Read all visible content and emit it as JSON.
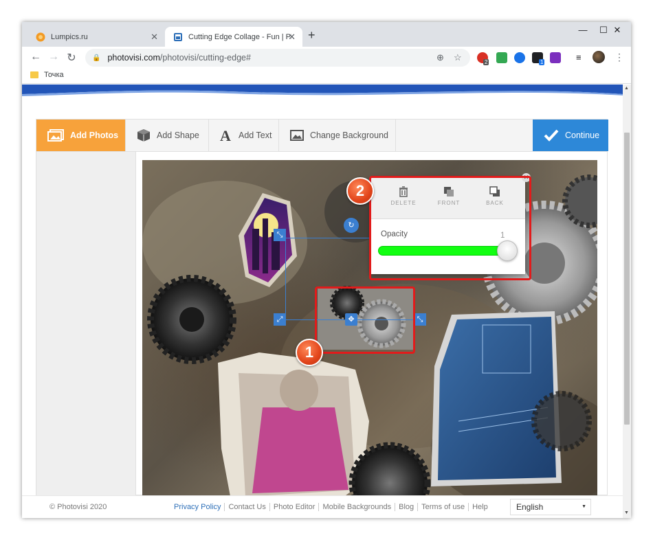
{
  "browser": {
    "tabs": [
      {
        "title": "Lumpics.ru",
        "active": false
      },
      {
        "title": "Cutting Edge Collage - Fun | Photovisi",
        "active": true
      }
    ],
    "new_tab": "+",
    "controls": {
      "minimize": "—",
      "maximize": "☐",
      "close": "✕"
    },
    "url_host": "photovisi.com",
    "url_path": "/photovisi/cutting-edge#",
    "bookmark": "Точка",
    "extension_badges": [
      "2",
      "1"
    ]
  },
  "editor": {
    "tabs": {
      "add_photos": "Add Photos",
      "add_shape": "Add Shape",
      "add_text": "Add Text",
      "change_background": "Change Background",
      "continue": "Continue"
    },
    "popup": {
      "delete": "DELETE",
      "front": "FRONT",
      "back": "BACK",
      "opacity_label": "Opacity",
      "opacity_value": "1",
      "opacity_level": 1.0
    },
    "markers": [
      "1",
      "2"
    ]
  },
  "footer": {
    "copyright": "© Photovisi 2020",
    "links": [
      "Privacy Policy",
      "Contact Us",
      "Photo Editor",
      "Mobile Backgrounds",
      "Blog",
      "Terms of use",
      "Help"
    ],
    "language": "English"
  },
  "colors": {
    "add_photos_bg": "#f7a23b",
    "continue_bg": "#2d88d8",
    "slider_fill": "#11ff11",
    "highlight_red": "#e21b1b",
    "selection_blue": "#3b7fd0"
  }
}
